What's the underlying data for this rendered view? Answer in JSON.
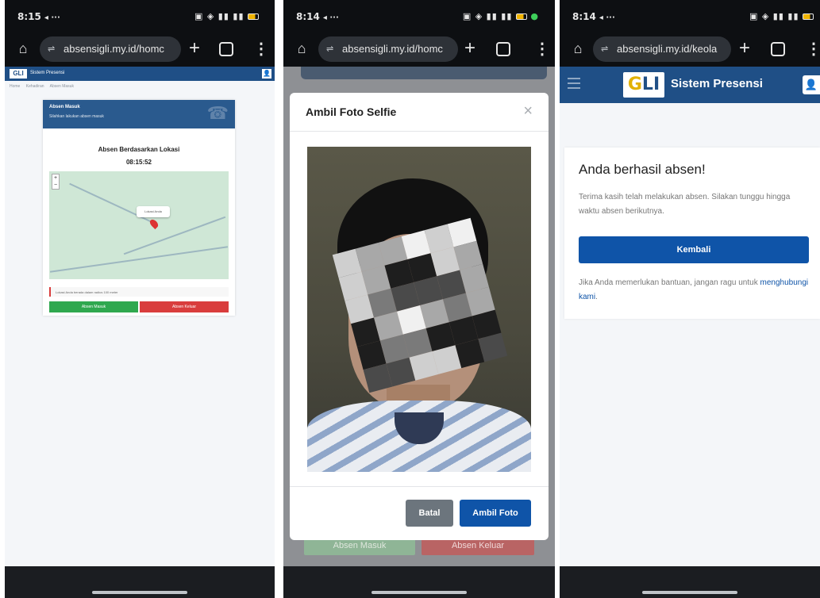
{
  "status": {
    "p1_time": "8:15",
    "p2_time": "8:14",
    "p3_time": "8:14",
    "nav_glyph": "◂ ···",
    "icons": "▣ ◈ ▮▮ ▮▮ ◉"
  },
  "browser": {
    "url_home": "absensigli.my.id/homc",
    "url_p2": "absensigli.my.id/homc",
    "url_p3": "absensigli.my.id/keola",
    "tab_count": ""
  },
  "panel1": {
    "app_title": "Sistem Presensi",
    "logo": "GLI",
    "breadcrumb": [
      "Home",
      "Kehadiran",
      "Absen Masuk"
    ],
    "card_title": "Absen Masuk",
    "card_subtitle": "Silahkan lakukan absen masuk",
    "location_title": "Absen Berdasarkan Lokasi",
    "time": "08:15:52",
    "map_popup": "Lokasi Anda",
    "zoom_in": "+",
    "zoom_out": "−",
    "info_text": "Lokasi Anda berada dalam radius 100 meter",
    "btn_green": "Absen Masuk",
    "btn_red": "Absen Keluar"
  },
  "panel2": {
    "modal_title": "Ambil Foto Selfie",
    "close": "×",
    "btn_cancel": "Batal",
    "btn_capture": "Ambil Foto",
    "dim_green": "Absen Masuk",
    "dim_red": "Absen Keluar"
  },
  "panel3": {
    "logo": "GLI",
    "brand": "Sistem Presensi",
    "heading": "Anda berhasil absen!",
    "message": "Terima kasih telah melakukan absen. Silakan tunggu hingga waktu absen berikutnya.",
    "button": "Kembali",
    "help_prefix": "Jika Anda memerlukan bantuan, jangan ragu untuk ",
    "help_link": "menghubungi kami",
    "help_suffix": "."
  },
  "colors": {
    "brand_blue": "#1f4f86",
    "primary": "#0f54a8",
    "success": "#2fa84f",
    "danger": "#d93d3d",
    "secondary": "#6c757d"
  }
}
